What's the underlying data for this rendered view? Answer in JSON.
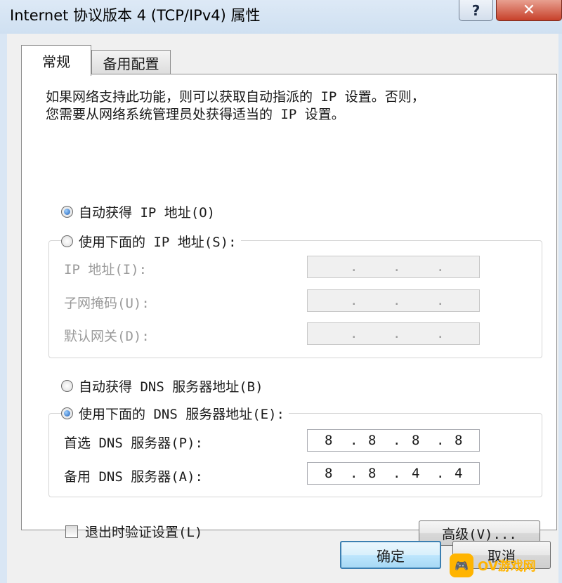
{
  "window": {
    "title": "Internet 协议版本 4 (TCP/IPv4) 属性",
    "help_label": "?",
    "close_label": "✕"
  },
  "tabs": [
    {
      "label": "常规"
    },
    {
      "label": "备用配置"
    }
  ],
  "description": {
    "line1": "如果网络支持此功能，则可以获取自动指派的 IP 设置。否则，",
    "line2": "您需要从网络系统管理员处获得适当的 IP 设置。"
  },
  "ip": {
    "auto_label": "自动获得 IP 地址(O)",
    "manual_label": "使用下面的 IP 地址(S):",
    "auto_selected": true,
    "fields": [
      {
        "label": "IP 地址(I):",
        "value": [
          "",
          "",
          "",
          ""
        ],
        "enabled": false
      },
      {
        "label": "子网掩码(U):",
        "value": [
          "",
          "",
          "",
          ""
        ],
        "enabled": false
      },
      {
        "label": "默认网关(D):",
        "value": [
          "",
          "",
          "",
          ""
        ],
        "enabled": false
      }
    ]
  },
  "dns": {
    "auto_label": "自动获得 DNS 服务器地址(B)",
    "manual_label": "使用下面的 DNS 服务器地址(E):",
    "manual_selected": true,
    "preferred": {
      "label": "首选 DNS 服务器(P):",
      "octets": [
        "8",
        "8",
        "8",
        "8"
      ]
    },
    "alternate": {
      "label": "备用 DNS 服务器(A):",
      "octets": [
        "8",
        "8",
        "4",
        "4"
      ]
    }
  },
  "validate": {
    "label": "退出时验证设置(L)",
    "checked": false
  },
  "buttons": {
    "advanced": "高级(V)...",
    "ok": "确定",
    "cancel": "取消"
  },
  "watermark": {
    "icon": "gamepad-icon",
    "text": "OV游戏网"
  },
  "colors": {
    "accent": "#1e5fb6",
    "default_button_border": "#3c7fb1",
    "close_button": "#c7402a"
  }
}
